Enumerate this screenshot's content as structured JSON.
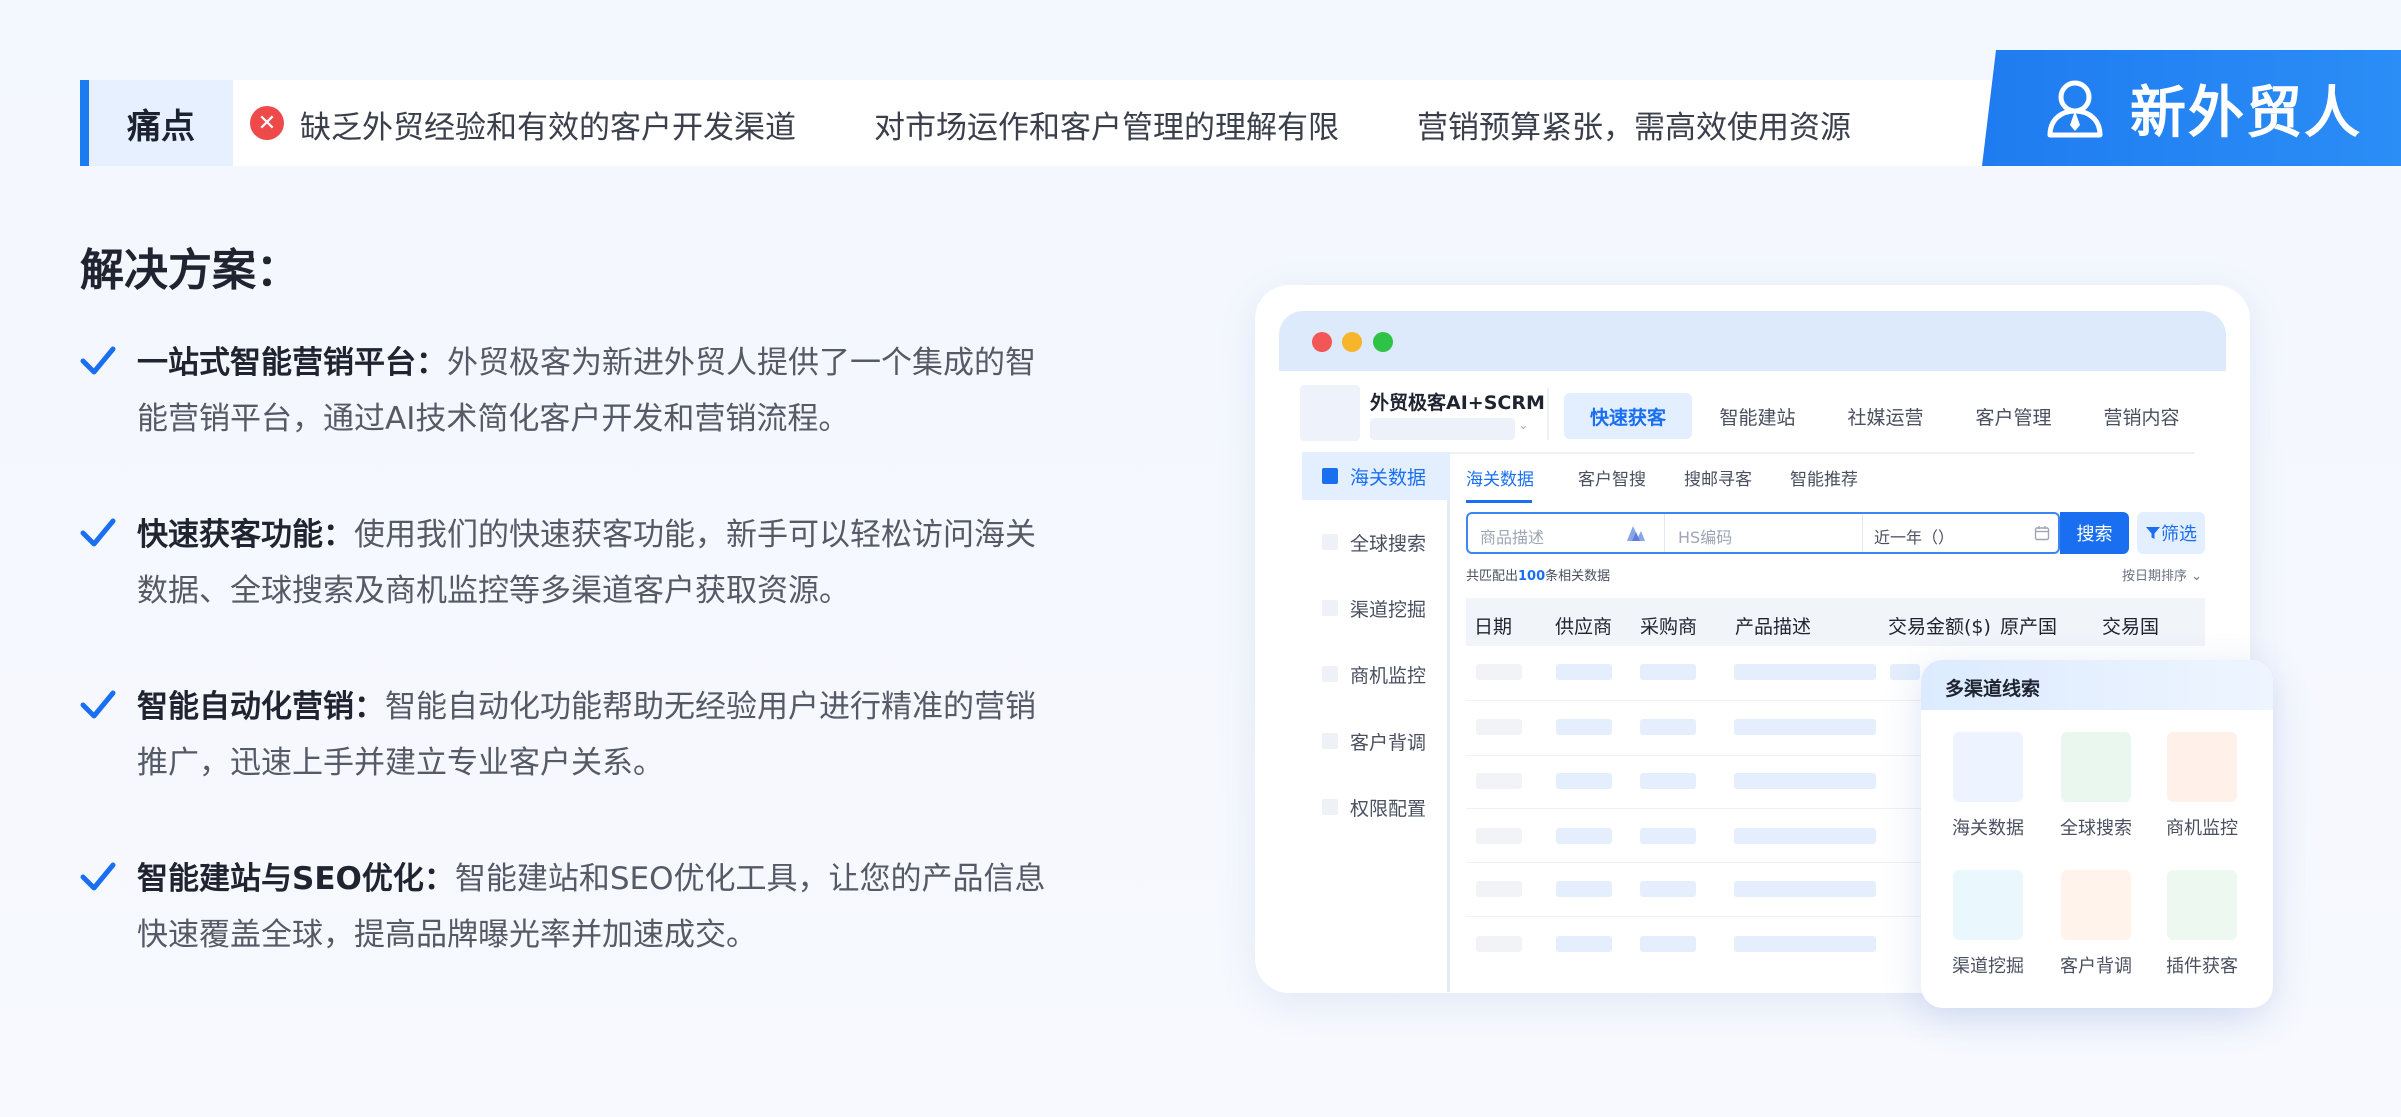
{
  "pain": {
    "label": "痛点",
    "items": [
      "缺乏外贸经验和有效的客户开发渠道",
      "对市场运作和客户管理的理解有限",
      "营销预算紧张，需高效使用资源"
    ]
  },
  "brand": {
    "text": "新外贸人"
  },
  "solutions": {
    "title": "解决方案：",
    "items": [
      {
        "head": "一站式智能营销平台：",
        "line1": "外贸极客为新进外贸人提供了一个集成的智",
        "line2": "能营销平台，通过AI技术简化客户开发和营销流程。"
      },
      {
        "head": "快速获客功能：",
        "line1": "使用我们的快速获客功能，新手可以轻松访问海关",
        "line2": "数据、全球搜索及商机监控等多渠道客户获取资源。"
      },
      {
        "head": "智能自动化营销：",
        "line1": "智能自动化功能帮助无经验用户进行精准的营销",
        "line2": "推广，迅速上手并建立专业客户关系。"
      },
      {
        "head": "智能建站与SEO优化：",
        "line1": "智能建站和SEO优化工具，让您的产品信息",
        "line2": "快速覆盖全球，提高品牌曝光率并加速成交。"
      }
    ]
  },
  "app": {
    "name": "外贸极客AI+SCRM",
    "top_nav": [
      "快速获客",
      "智能建站",
      "社媒运营",
      "客户管理",
      "营销内容"
    ],
    "side_nav": [
      "海关数据",
      "全球搜索",
      "渠道挖掘",
      "商机监控",
      "客户背调",
      "权限配置"
    ],
    "sub_tabs": [
      "海关数据",
      "客户智搜",
      "搜邮寻客",
      "智能推荐"
    ],
    "search": {
      "product_placeholder": "商品描述",
      "hs_placeholder": "HS编码",
      "date_value": "近一年（）",
      "button": "搜索",
      "filter": "筛选"
    },
    "match": {
      "prefix": "共匹配出",
      "count": "100",
      "suffix": "条相关数据"
    },
    "sort_label": "按日期排序 ⌄",
    "table_headers": [
      "日期",
      "供应商",
      "采购商",
      "产品描述",
      "交易金额($)",
      "原产国",
      "交易国"
    ]
  },
  "card": {
    "title": "多渠道线索",
    "tiles": [
      "海关数据",
      "全球搜索",
      "商机监控",
      "渠道挖掘",
      "客户背调",
      "插件获客"
    ]
  },
  "colors": {
    "accent": "#1a6ff0",
    "brand": "#1f7cf0",
    "error": "#ef4a4a"
  }
}
